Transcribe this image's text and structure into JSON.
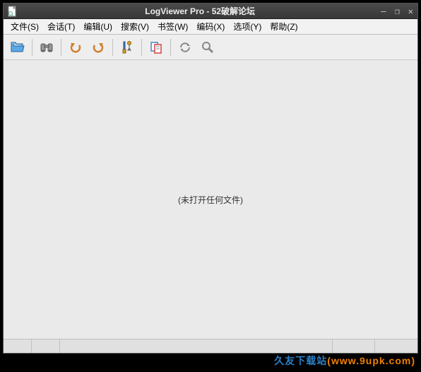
{
  "title": "LogViewer Pro - 52破解论坛",
  "menu": {
    "file": "文件(S)",
    "session": "会话(T)",
    "edit": "编辑(U)",
    "search": "搜索(V)",
    "bookmark": "书签(W)",
    "encoding": "编码(X)",
    "options": "选项(Y)",
    "help": "帮助(Z)"
  },
  "content": {
    "empty_message": "(未打开任何文件)"
  },
  "watermark": {
    "site": "久友下载站",
    "url": "(www.9upk.com)"
  },
  "colors": {
    "title_bg": "#404040",
    "folder_icon": "#3a8bd8",
    "tool_icon": "#888888",
    "orange": "#f0a030"
  }
}
